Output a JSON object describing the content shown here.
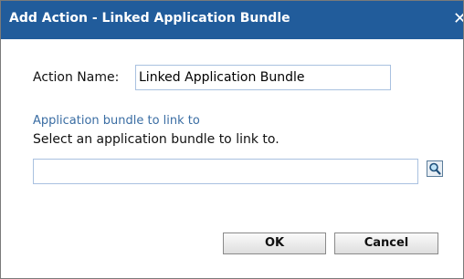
{
  "dialog": {
    "title": "Add Action - Linked Application Bundle",
    "close_glyph": "✕"
  },
  "form": {
    "action_name_label": "Action Name:",
    "action_name_value": "Linked Application Bundle",
    "bundle_section_title": "Application bundle to link to",
    "bundle_instruction": "Select an application bundle to link to.",
    "bundle_value": "",
    "browse_icon": "magnifier-icon"
  },
  "buttons": {
    "ok_label": "OK",
    "cancel_label": "Cancel"
  },
  "colors": {
    "titlebar": "#215c9b",
    "section_title": "#3a6da3"
  }
}
